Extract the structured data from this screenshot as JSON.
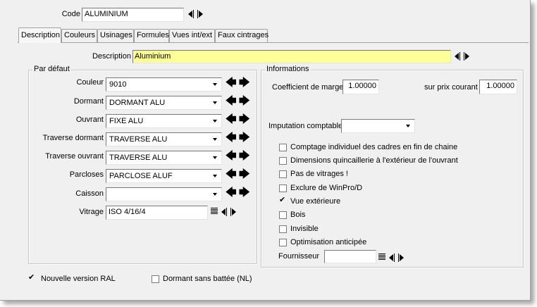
{
  "code": {
    "label": "Code",
    "value": "ALUMINIUM"
  },
  "tabs": [
    {
      "label": "Description",
      "active": true
    },
    {
      "label": "Couleurs"
    },
    {
      "label": "Usinages"
    },
    {
      "label": "Formules"
    },
    {
      "label": "Vues int/ext"
    },
    {
      "label": "Faux cintrages"
    }
  ],
  "description": {
    "label": "Description",
    "value": "Aluminium"
  },
  "par_defaut": {
    "title": "Par défaut",
    "rows": [
      {
        "label": "Couleur",
        "value": "9010"
      },
      {
        "label": "Dormant",
        "value": "DORMANT ALU"
      },
      {
        "label": "Ouvrant",
        "value": "FIXE ALU"
      },
      {
        "label": "Traverse dormant",
        "value": "TRAVERSE ALU"
      },
      {
        "label": "Traverse ouvrant",
        "value": "TRAVERSE ALU"
      },
      {
        "label": "Parcloses",
        "value": "PARCLOSE ALUF"
      },
      {
        "label": "Caisson",
        "value": ""
      }
    ],
    "vitrage": {
      "label": "Vitrage",
      "value": "ISO 4/16/4"
    },
    "arrow_left": "🡄",
    "arrow_right": "🡆"
  },
  "informations": {
    "title": "Informations",
    "coef_label": "Coefficient de marge",
    "coef_value": "1.00000",
    "prix_label": "sur prix courant",
    "prix_value": "1.00000",
    "imputation_label": "Imputation comptable",
    "imputation_value": "",
    "checks": [
      {
        "label": "Comptage individuel des cadres en fin de chaine",
        "checked": false
      },
      {
        "label": "Dimensions quincaillerie à l'extérieur de l'ouvrant",
        "checked": false
      },
      {
        "label": "Pas de vitrages !",
        "checked": false
      },
      {
        "label": "Exclure de WinPro/D",
        "checked": false
      },
      {
        "label": "Vue extérieure",
        "checked": true
      },
      {
        "label": "Bois",
        "checked": false
      },
      {
        "label": "Invisible",
        "checked": false
      },
      {
        "label": "Optimisation anticipée",
        "checked": false
      }
    ],
    "fournisseur_label": "Fournisseur",
    "fournisseur_value": ""
  },
  "bottom": {
    "nouvelle_version_label": "Nouvelle version RAL",
    "nouvelle_version_checked": true,
    "dormant_label": "Dormant sans battée (NL)",
    "dormant_checked": false
  },
  "colors": {
    "window_bg": "#f0f0f0",
    "description_field": "#ffff99",
    "border": "#a0a0a0"
  }
}
